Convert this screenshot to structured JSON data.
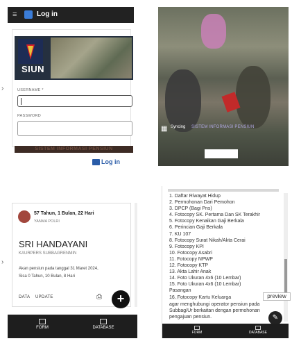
{
  "login": {
    "title": "Log in",
    "app_name": "SIUN",
    "username_label": "USERNAME *",
    "password_label": "PASSWORD",
    "footer_text": "SISTEM INFORMASI PENSIUN",
    "login_button": "Log in"
  },
  "splash": {
    "sync_label": "Syncing",
    "sync_sub": "SISTEM INFORMASI PENSIUN"
  },
  "profile": {
    "age": "57 Tahun, 1 Bulan, 22 Hari",
    "unit": "YANMA POLRI",
    "name": "SRI HANDAYANI",
    "dept": "KAURPERS SUBBAGRENMIN",
    "note_line1": "Akan pensiun pada tanggal 31 Maret 2024,",
    "note_line2": "Sisa 0 Tahun, 10 Bulan, 8 Hari",
    "actions": {
      "data": "DATA",
      "update": "UPDATE"
    },
    "fab": "+",
    "tabs": {
      "form": "FORM",
      "database": "DATABASE"
    }
  },
  "documents": {
    "items": [
      "1. Daftar Riwayat Hidup",
      "2. Permohonan Dari Pemohon",
      "3. DPCP (Bagi Pns)",
      "4. Fotocopy SK. Pertama Dan SK Terakhir",
      "5. Fotocopy Kenaikan Gaji Berkala",
      "6. Perincian Gaji Berkala",
      "7. KU 107",
      "8. Fotocopy Surat Nikah/Akta Cerai",
      "9. Fotocopy KPI",
      "10. Fotocopy Asabri",
      "11. Fotocopy NPWP",
      "12. Fotocopy KTP",
      "13. Akta Lahir Anak",
      "14. Foto Ukuran 4x6 (10 Lembar)",
      "15. Foto Ukuran 4x6 (10 Lembar)",
      "Pasangan",
      "16. Fotocopy Kartu Keluarga"
    ],
    "para_line1": "agar menghubungi operator pensiun pada",
    "para_line2": "Subbag/Ur berkaitan dengan permohonan",
    "para_line3": "pengajuan pensiun.",
    "preview_button": "preview",
    "tabs": {
      "form": "FORM",
      "database": "DATABASE"
    }
  }
}
